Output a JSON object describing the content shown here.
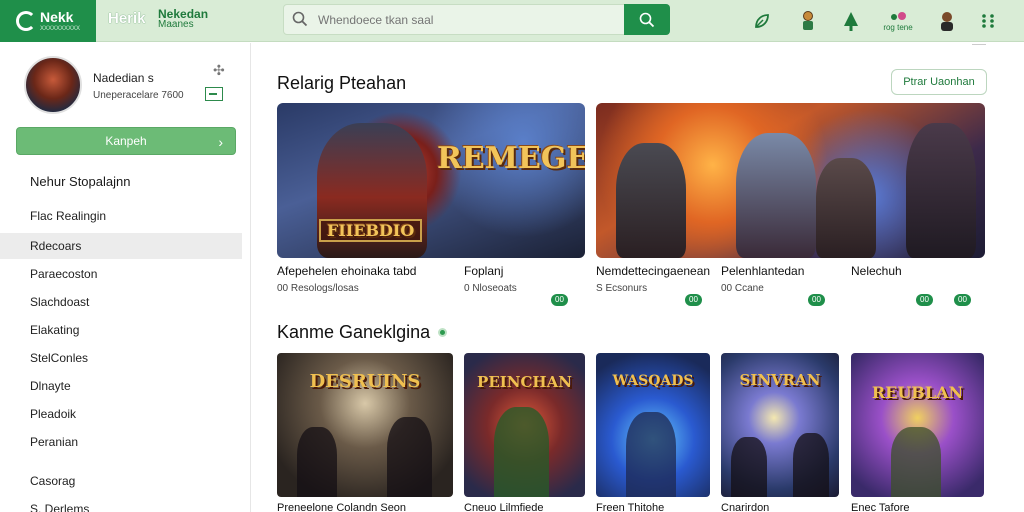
{
  "app": {
    "logo_text": "Nekk",
    "logo_sub": "ХХХХХХХХХХ",
    "brand": "Herik",
    "brand_sub_a": "Nekedan",
    "brand_sub_b": "Maanes"
  },
  "search": {
    "placeholder": "Whendoece tkan saal"
  },
  "top_icons": [
    {
      "name": "leaf-icon",
      "caption": ""
    },
    {
      "name": "character-icon",
      "caption": ""
    },
    {
      "name": "tree-icon",
      "caption": ""
    },
    {
      "name": "notifications-icon",
      "caption": "rog tene"
    },
    {
      "name": "avatar-icon",
      "caption": ""
    },
    {
      "name": "grid-menu-icon",
      "caption": ""
    }
  ],
  "profile": {
    "name": "Nadedian s",
    "meta": "Uneperacelare 7600"
  },
  "sidebar": {
    "button_label": "Kanpeh",
    "heading": "Nehur Stopalajnn",
    "items": [
      {
        "label": "Flac Realingin",
        "active": false
      },
      {
        "label": "Rdecoars",
        "active": true
      },
      {
        "label": "Paraecoston",
        "active": false
      },
      {
        "label": "Slachdoast",
        "active": false
      },
      {
        "label": "Elakating",
        "active": false
      },
      {
        "label": "StelConles",
        "active": false
      },
      {
        "label": "Dlnayte",
        "active": false
      },
      {
        "label": "Pleadoik",
        "active": false
      },
      {
        "label": "Peranian",
        "active": false
      }
    ],
    "footer_items": [
      {
        "label": "Casorag"
      },
      {
        "label": "S. Derlems"
      }
    ]
  },
  "main": {
    "title": "Relarig Pteahan",
    "filter_button": "Ptrar Uaonhan",
    "featured": [
      {
        "art_title": "REMEGEAN",
        "art_sub": "FIIEBDIO"
      },
      {
        "art_title": "",
        "art_sub": ""
      }
    ],
    "featured_captions": [
      {
        "title": "Afepehelen ehoinaka tabd",
        "meta": "00 Resologs/losas"
      },
      {
        "title": "Foplanj",
        "meta": "0 Nloseoats",
        "badge": "00"
      },
      {
        "title": "Nemdettecingaenean",
        "meta": "S Ecsonurs",
        "badge": "00"
      },
      {
        "title": "Pelenhlantedan",
        "meta": "00 Ccane",
        "badge": "00"
      },
      {
        "title": "Nelechuh",
        "meta": "",
        "badges": [
          "00",
          "00"
        ]
      }
    ],
    "section2_title": "Kanme Ganeklgina",
    "small_cards": [
      {
        "art": "DESRUINS",
        "caption": "Preneelone Colandn Seon"
      },
      {
        "art": "PEINCHAN",
        "caption": "Cneuo Lilmfiede"
      },
      {
        "art": "WASQADS",
        "caption": "Freen Thitohe"
      },
      {
        "art": "SINVRAN",
        "caption": "Cnarirdon"
      },
      {
        "art": "REUBLAN",
        "caption": "Enec Tafore"
      }
    ]
  }
}
